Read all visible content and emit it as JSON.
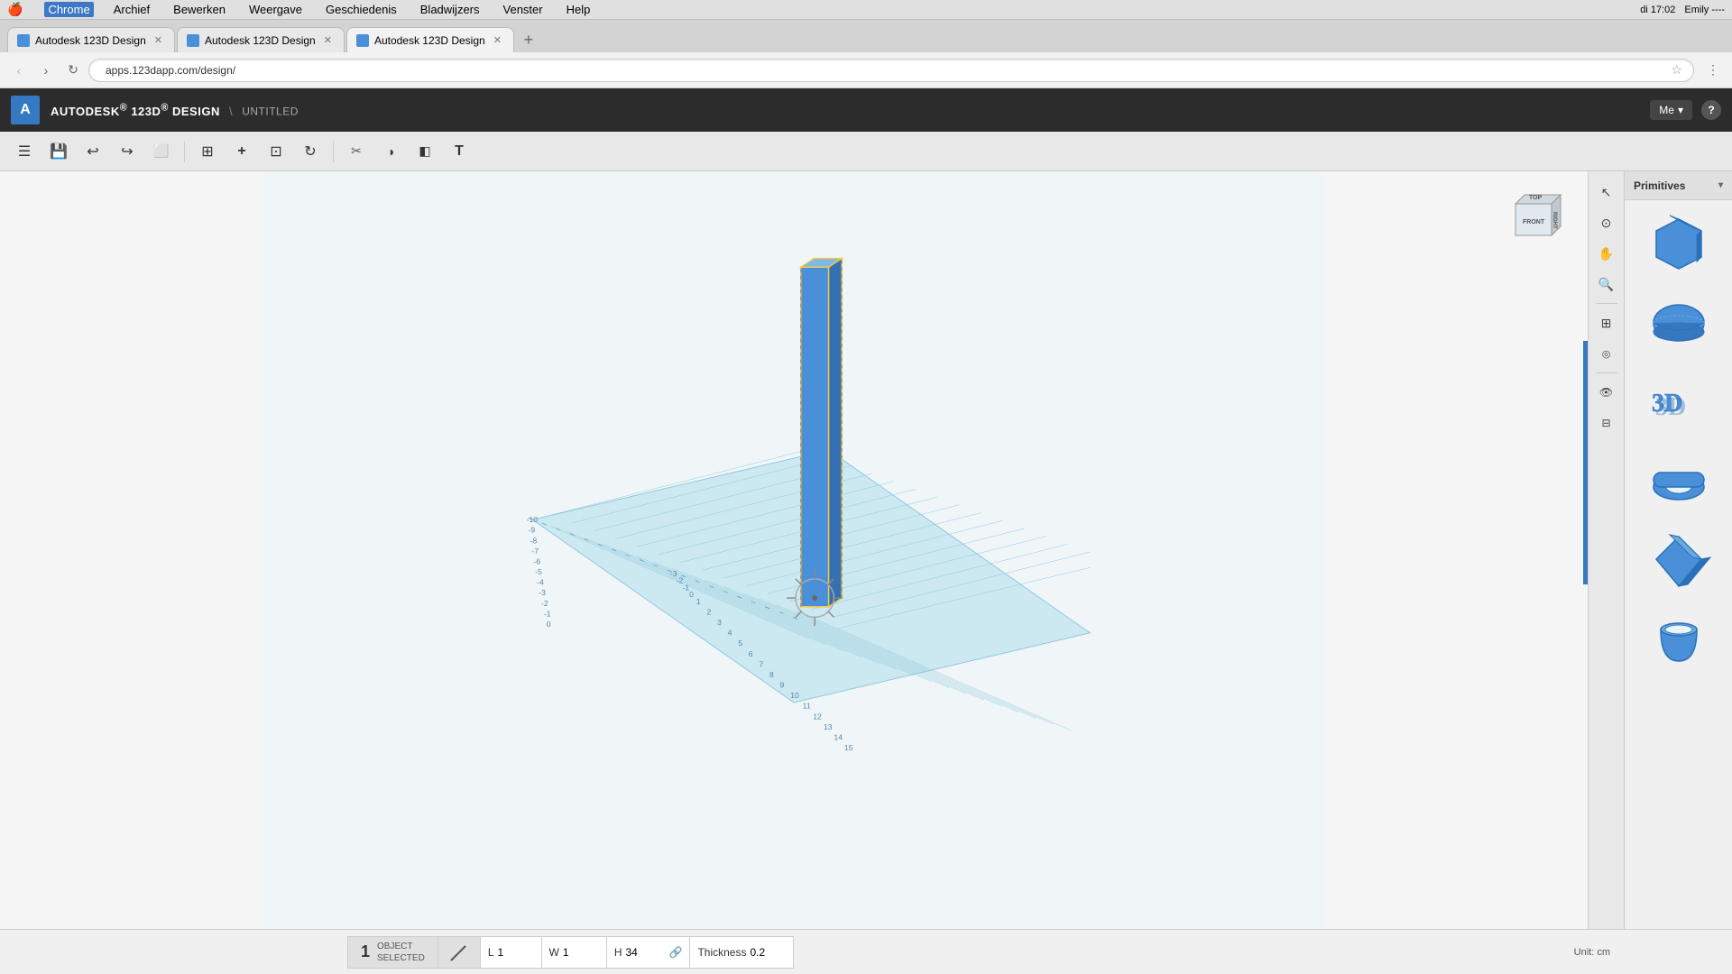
{
  "macMenubar": {
    "apple": "🍎",
    "items": [
      "Chrome",
      "Archief",
      "Bewerken",
      "Weergave",
      "Geschiedenis",
      "Bladwijzers",
      "Venster",
      "Help"
    ],
    "activeItem": "Chrome",
    "rightItems": [
      "di 17:02",
      "Emily ----"
    ]
  },
  "chromeTabs": [
    {
      "id": "tab1",
      "title": "Autodesk 123D Design",
      "active": false,
      "favicon": true
    },
    {
      "id": "tab2",
      "title": "Autodesk 123D Design",
      "active": false,
      "favicon": true
    },
    {
      "id": "tab3",
      "title": "Autodesk 123D Design",
      "active": true,
      "favicon": true
    }
  ],
  "addressBar": {
    "url": "apps.123dapp.com/design/",
    "secure": false
  },
  "appHeader": {
    "logoText": "A",
    "brandPrefix": "AUTODESK",
    "brandSuperscript": "®",
    "brand123": "123D",
    "brandDesign": "DESIGN",
    "separator": "\\",
    "filename": "UNTITLED",
    "meLabel": "Me",
    "helpLabel": "?"
  },
  "toolbar": {
    "buttons": [
      {
        "name": "menu-btn",
        "icon": "☰",
        "label": "Menu"
      },
      {
        "name": "save-btn",
        "icon": "💾",
        "label": "Save"
      },
      {
        "name": "undo-btn",
        "icon": "↩",
        "label": "Undo"
      },
      {
        "name": "redo-btn",
        "icon": "↪",
        "label": "Redo"
      },
      {
        "name": "copy-btn",
        "icon": "□",
        "label": "Copy"
      },
      {
        "name": "view-toggle-btn",
        "icon": "⊞",
        "label": "View Toggle"
      },
      {
        "name": "add-btn",
        "icon": "+",
        "label": "Add"
      },
      {
        "name": "snap-btn",
        "icon": "⊡",
        "label": "Snap"
      },
      {
        "name": "refresh-btn",
        "icon": "↻",
        "label": "Refresh"
      },
      {
        "name": "transform-btn",
        "icon": "✂",
        "label": "Transform"
      },
      {
        "name": "materials-btn",
        "icon": "◑",
        "label": "Materials"
      },
      {
        "name": "solid-btn",
        "icon": "◧",
        "label": "Solid"
      },
      {
        "name": "text-btn",
        "icon": "T",
        "label": "Text"
      }
    ]
  },
  "rightTools": [
    {
      "name": "select-tool",
      "icon": "↖",
      "label": "Select"
    },
    {
      "name": "orbit-tool",
      "icon": "⊙",
      "label": "Orbit"
    },
    {
      "name": "pan-tool",
      "icon": "✋",
      "label": "Pan"
    },
    {
      "name": "zoom-tool",
      "icon": "🔍",
      "label": "Zoom"
    },
    {
      "name": "fit-tool",
      "icon": "⊞",
      "label": "Fit"
    },
    {
      "name": "isolate-tool",
      "icon": "◎",
      "label": "Isolate"
    },
    {
      "name": "eye-tool",
      "icon": "👁",
      "label": "Show/Hide"
    },
    {
      "name": "grid-tool",
      "icon": "⊟",
      "label": "Grid"
    }
  ],
  "viewCube": {
    "topLabel": "TOP",
    "frontLabel": "FRONT",
    "rightLabel": "RIGHT"
  },
  "primitivesPanel": {
    "title": "Primitives",
    "items": [
      {
        "name": "box",
        "color": "#4a90d9"
      },
      {
        "name": "sphere",
        "color": "#4a90d9"
      },
      {
        "name": "3d-text",
        "color": "#4a90d9"
      },
      {
        "name": "torus",
        "color": "#4a90d9"
      },
      {
        "name": "diamond",
        "color": "#4a90d9"
      },
      {
        "name": "cup",
        "color": "#4a90d9"
      }
    ]
  },
  "statusBar": {
    "objectCount": "1",
    "objectLabel": "OBJECT\nSELECTED",
    "toolIndicatorIcon": "↗",
    "dimensions": {
      "L": {
        "label": "L",
        "value": "1"
      },
      "W": {
        "label": "W",
        "value": "1"
      },
      "H": {
        "label": "H",
        "value": "34"
      },
      "Thickness": {
        "label": "Thickness",
        "value": "0.2"
      }
    },
    "unit": "Unit:  cm"
  },
  "scene": {
    "gridColor": "#b8dce8",
    "gridLineColor": "#7fbfd4",
    "objectColor": "#4a90d9",
    "objectHighlight": "#f5c842",
    "backgroundColor": "#f0f6f8"
  }
}
